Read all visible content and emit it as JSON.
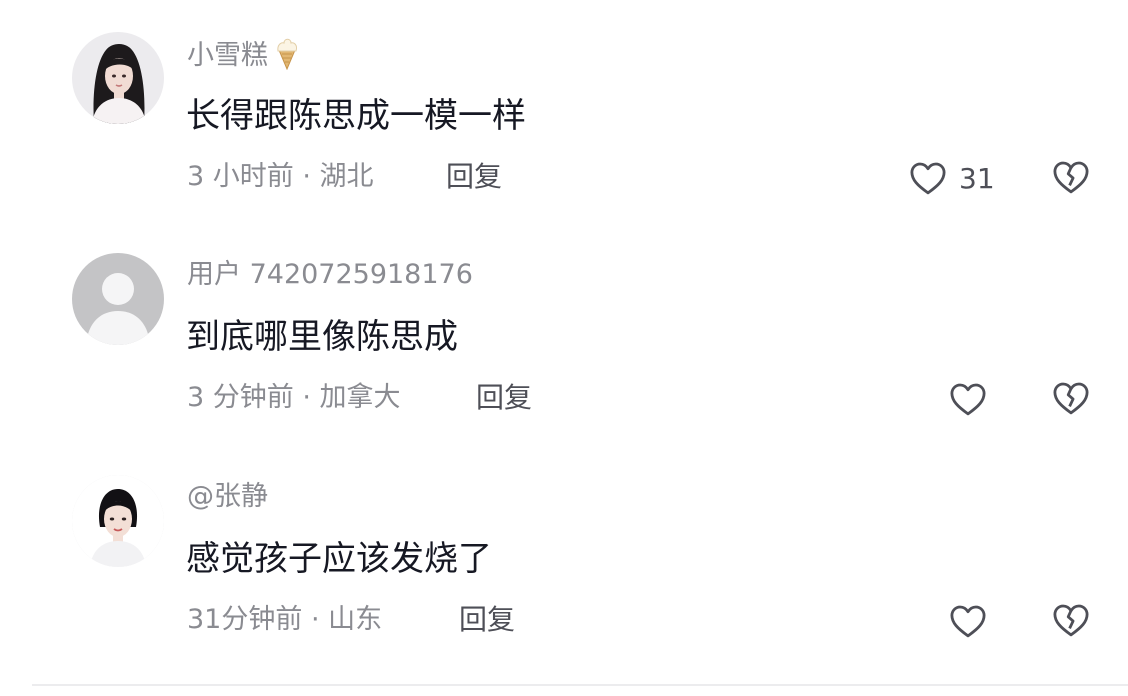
{
  "comments": [
    {
      "username": "小雪糕",
      "username_emoji": "ice-cream-icon",
      "text": "长得跟陈思成一模一样",
      "meta": "3 小时前 · 湖北",
      "reply_label": "回复",
      "like_count": "31"
    },
    {
      "username": "用户 7420725918176",
      "text": "到底哪里像陈思成",
      "meta": "3 分钟前 · 加拿大",
      "reply_label": "回复",
      "like_count": ""
    },
    {
      "username": "@张静",
      "text": "感觉孩子应该发烧了",
      "meta": "31分钟前 · 山东",
      "reply_label": "回复",
      "like_count": ""
    }
  ],
  "colors": {
    "username": "#8a8b91",
    "text": "#161823",
    "action": "#4e4f57",
    "default_avatar_bg": "#c4c4c6"
  }
}
